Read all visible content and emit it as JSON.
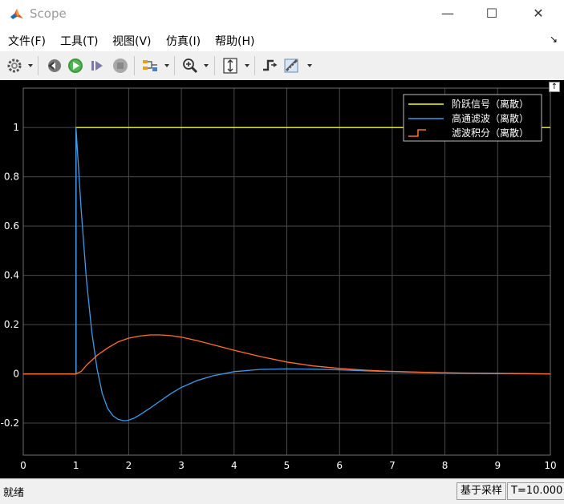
{
  "window": {
    "title": "Scope",
    "minimize": "—",
    "maximize": "☐",
    "close": "✕"
  },
  "menu": {
    "items": [
      "文件(F)",
      "工具(T)",
      "视图(V)",
      "仿真(I)",
      "帮助(H)"
    ],
    "corner_glyph": "↘"
  },
  "toolbar": {
    "icons": [
      "gear-icon",
      "step-back-icon",
      "run-icon",
      "step-forward-icon",
      "stop-icon",
      "signal-selector-icon",
      "zoom-in-icon",
      "fit-axes-icon",
      "triggers-icon",
      "measure-icon"
    ]
  },
  "plot": {
    "undock_glyph": "↑"
  },
  "chart_data": {
    "type": "line",
    "title": "",
    "xlabel": "",
    "ylabel": "",
    "xlim": [
      0,
      10
    ],
    "ylim": [
      -0.33,
      1.16
    ],
    "xticks": [
      "0",
      "1",
      "2",
      "3",
      "4",
      "5",
      "6",
      "7",
      "8",
      "9",
      "10"
    ],
    "yticks": [
      "-0.2",
      "0",
      "0.2",
      "0.4",
      "0.6",
      "0.8",
      "1"
    ],
    "grid": true,
    "legend_position": "top-right",
    "colors": {
      "background": "#000000",
      "axes_text": "#ffffff",
      "grid": "#4a4a4a"
    },
    "series": [
      {
        "name": "阶跃信号（离散）",
        "color": "#ffff00",
        "style": "step",
        "x": [
          0,
          1,
          1,
          10
        ],
        "y": [
          0,
          0,
          1,
          1
        ]
      },
      {
        "name": "高通滤波（离散）",
        "color": "#3d9be9",
        "x": [
          0,
          1,
          1,
          1.1,
          1.2,
          1.3,
          1.4,
          1.5,
          1.6,
          1.7,
          1.8,
          1.9,
          1.95,
          2.0,
          2.1,
          2.2,
          2.4,
          2.6,
          2.8,
          3.0,
          3.3,
          3.6,
          4.0,
          4.5,
          5.0,
          5.5,
          6.0,
          6.5,
          7.0,
          7.5,
          8.0,
          8.5,
          9.0,
          9.5,
          10
        ],
        "y": [
          0,
          0,
          1.0,
          0.66,
          0.38,
          0.17,
          0.02,
          -0.08,
          -0.14,
          -0.17,
          -0.185,
          -0.19,
          -0.19,
          -0.188,
          -0.18,
          -0.168,
          -0.14,
          -0.11,
          -0.08,
          -0.055,
          -0.027,
          -0.008,
          0.009,
          0.018,
          0.02,
          0.019,
          0.016,
          0.012,
          0.009,
          0.006,
          0.004,
          0.002,
          0.001,
          0.0005,
          0
        ]
      },
      {
        "name": "滤波积分（离散）",
        "color": "#ff6f2e",
        "x": [
          0,
          1,
          1.1,
          1.2,
          1.4,
          1.6,
          1.8,
          2.0,
          2.2,
          2.4,
          2.6,
          2.8,
          3.0,
          3.3,
          3.6,
          4.0,
          4.5,
          5.0,
          5.5,
          6.0,
          6.5,
          7.0,
          7.5,
          8.0,
          8.5,
          9.0,
          9.5,
          10
        ],
        "y": [
          0,
          0,
          0.01,
          0.035,
          0.075,
          0.105,
          0.13,
          0.145,
          0.153,
          0.158,
          0.158,
          0.155,
          0.149,
          0.135,
          0.118,
          0.096,
          0.07,
          0.048,
          0.032,
          0.022,
          0.015,
          0.01,
          0.007,
          0.004,
          0.003,
          0.002,
          0.001,
          0
        ]
      }
    ]
  },
  "status": {
    "left": "就绪",
    "mode": "基于采样",
    "time": "T=10.000"
  }
}
